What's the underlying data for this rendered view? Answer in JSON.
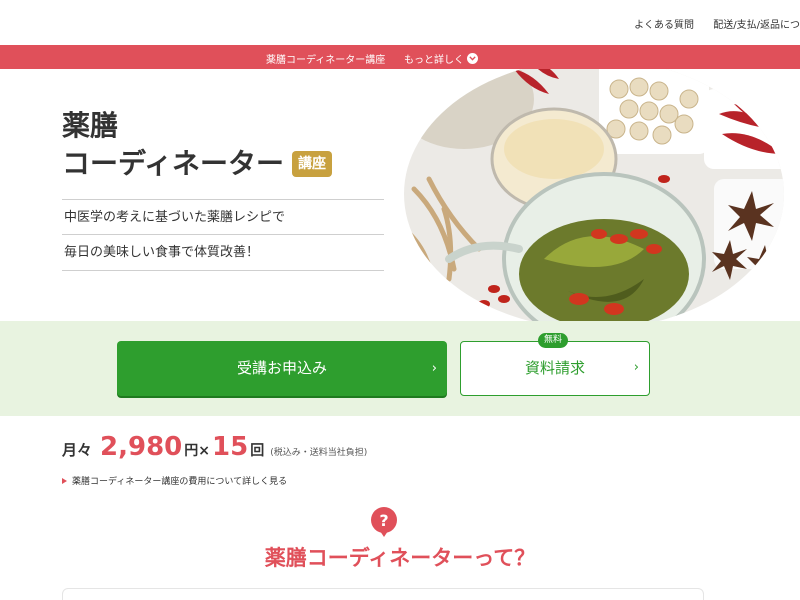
{
  "topbar": {
    "links": [
      "よくある質問",
      "配送/支払/返品につ"
    ]
  },
  "nav": {
    "course_title": "薬膳コーディネーター講座",
    "more_label": "もっと詳しく"
  },
  "hero": {
    "title_line1": "薬膳",
    "title_line2": "コーディネーター",
    "badge": "講座",
    "desc_line1": "中医学の考えに基づいた薬膳レシピで",
    "desc_line2": "毎日の美味しい食事で体質改善！"
  },
  "cta": {
    "apply_label": "受講お申込み",
    "request_label": "資料請求",
    "free_badge": "無料",
    "arrow": "›"
  },
  "price": {
    "prefix": "月々",
    "amount": "2,980",
    "unit": "円×",
    "times": "15",
    "times_unit": "回",
    "note": "(税込み・送料当社負担)",
    "detail_link": "薬膳コーディネーター講座の費用について詳しく見る"
  },
  "section": {
    "question_title": "薬膳コーディネーターって？"
  },
  "colors": {
    "accent_red": "#e0505a",
    "green": "#2e9e2e",
    "gold": "#c8a13f",
    "cta_band": "#e8f3e0"
  }
}
